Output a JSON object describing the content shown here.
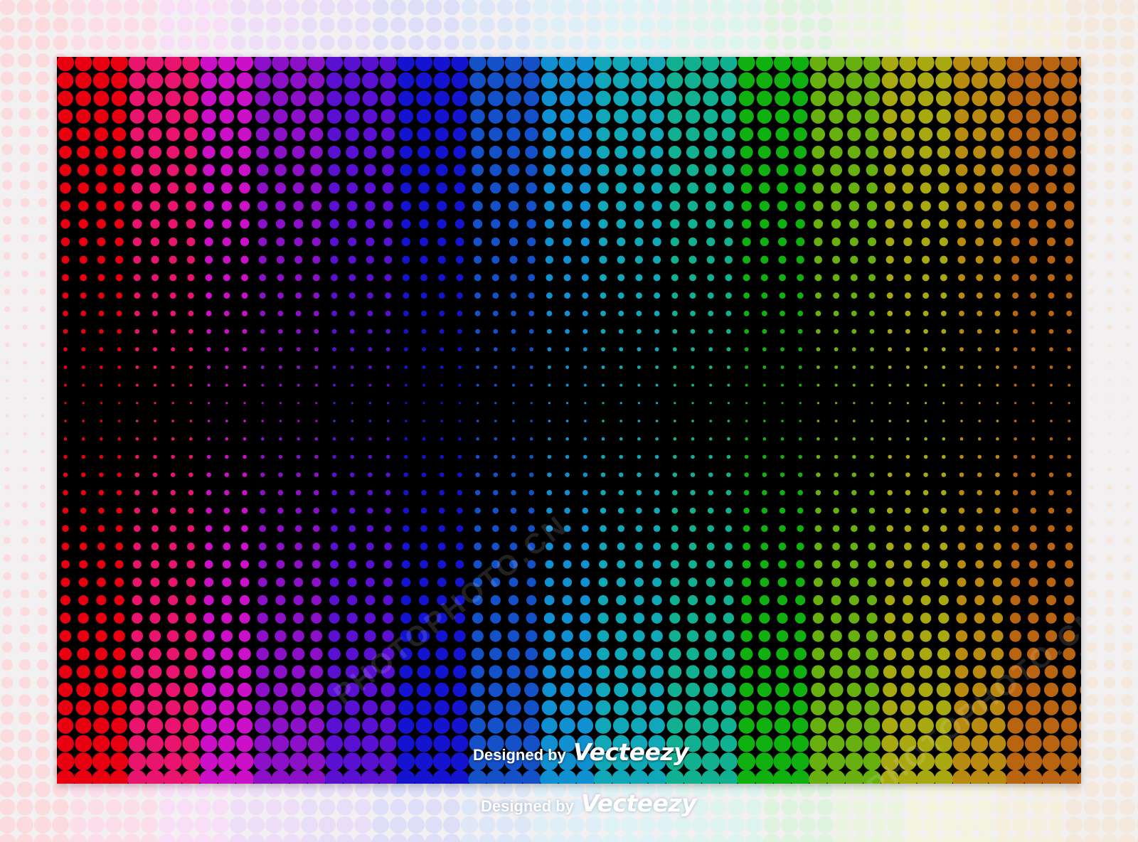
{
  "artwork": {
    "title": "",
    "colors": {
      "page_bg": "#f3f0f2",
      "panel_bg": "#000000",
      "bands": [
        "#e80010",
        "#e8146e",
        "#cc10c8",
        "#8c10c8",
        "#5a10d0",
        "#1414d0",
        "#1450c8",
        "#1090d0",
        "#10a8b8",
        "#10b090",
        "#10b010",
        "#68b010",
        "#a8a810",
        "#b88a10",
        "#b86410"
      ]
    }
  },
  "credit": {
    "prefix": "Designed by",
    "brand": "Vecteezy"
  },
  "watermark": {
    "text": "PHOTOPHOTO.CN"
  }
}
